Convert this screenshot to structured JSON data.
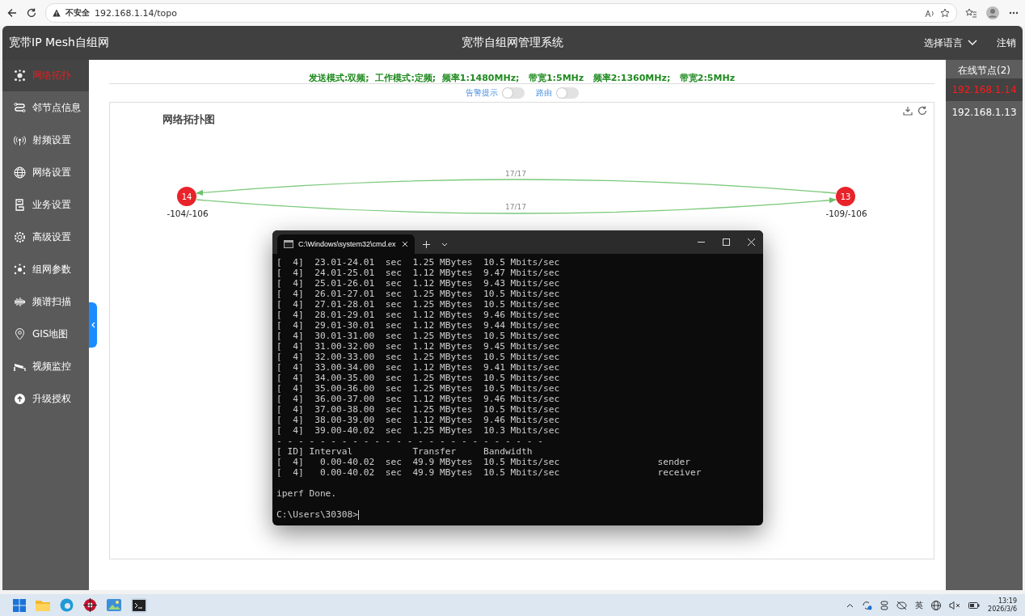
{
  "browser": {
    "security": "不安全",
    "url": "192.168.1.14/topo"
  },
  "header": {
    "brand": "宽带IP Mesh自组网",
    "title": "宽带自组网管理系统",
    "language": "选择语言",
    "logout": "注销"
  },
  "sidebar": {
    "items": [
      {
        "label": "网络拓扑",
        "selected": true
      },
      {
        "label": "邻节点信息",
        "selected": false
      },
      {
        "label": "射频设置",
        "selected": false
      },
      {
        "label": "网络设置",
        "selected": false
      },
      {
        "label": "业务设置",
        "selected": false
      },
      {
        "label": "高级设置",
        "selected": false
      },
      {
        "label": "组网参数",
        "selected": false
      },
      {
        "label": "频谱扫描",
        "selected": false
      },
      {
        "label": "GIS地图",
        "selected": false
      },
      {
        "label": "视频监控",
        "selected": false
      },
      {
        "label": "升级授权",
        "selected": false
      }
    ]
  },
  "status_line": "发送模式:双频;  工作模式:定频;  频率1:1480MHz;   带宽1:5MHz   频率2:1360MHz;   带宽2:5MHz",
  "toggles": [
    {
      "label": "告警提示",
      "on": false
    },
    {
      "label": "路由",
      "on": false
    }
  ],
  "topology": {
    "title": "网络拓扑图",
    "nodes": [
      {
        "label": "14",
        "signal": "-104/-106"
      },
      {
        "label": "13",
        "signal": "-109/-106"
      }
    ],
    "links": [
      {
        "label": "17/17",
        "points_left": true
      },
      {
        "label": "17/17",
        "points_left": false
      }
    ]
  },
  "online_nodes": {
    "title": "在线节点(2)",
    "items": [
      {
        "label": "192.168.1.14",
        "selected": true
      },
      {
        "label": "192.168.1.13",
        "selected": false
      }
    ]
  },
  "terminal": {
    "tab": "C:\\Windows\\system32\\cmd.ex",
    "lines": [
      "[  4]  23.01-24.01  sec  1.25 MBytes  10.5 Mbits/sec",
      "[  4]  24.01-25.01  sec  1.12 MBytes  9.47 Mbits/sec",
      "[  4]  25.01-26.01  sec  1.12 MBytes  9.43 Mbits/sec",
      "[  4]  26.01-27.01  sec  1.25 MBytes  10.5 Mbits/sec",
      "[  4]  27.01-28.01  sec  1.25 MBytes  10.5 Mbits/sec",
      "[  4]  28.01-29.01  sec  1.12 MBytes  9.46 Mbits/sec",
      "[  4]  29.01-30.01  sec  1.12 MBytes  9.44 Mbits/sec",
      "[  4]  30.01-31.00  sec  1.25 MBytes  10.5 Mbits/sec",
      "[  4]  31.00-32.00  sec  1.12 MBytes  9.45 Mbits/sec",
      "[  4]  32.00-33.00  sec  1.25 MBytes  10.5 Mbits/sec",
      "[  4]  33.00-34.00  sec  1.12 MBytes  9.41 Mbits/sec",
      "[  4]  34.00-35.00  sec  1.25 MBytes  10.5 Mbits/sec",
      "[  4]  35.00-36.00  sec  1.25 MBytes  10.5 Mbits/sec",
      "[  4]  36.00-37.00  sec  1.12 MBytes  9.46 Mbits/sec",
      "[  4]  37.00-38.00  sec  1.25 MBytes  10.5 Mbits/sec",
      "[  4]  38.00-39.00  sec  1.12 MBytes  9.46 Mbits/sec",
      "[  4]  39.00-40.02  sec  1.25 MBytes  10.3 Mbits/sec",
      "- - - - - - - - - - - - - - - - - - - - - - - - -",
      "[ ID] Interval           Transfer     Bandwidth",
      "[  4]   0.00-40.02  sec  49.9 MBytes  10.5 Mbits/sec                  sender",
      "[  4]   0.00-40.02  sec  49.9 MBytes  10.5 Mbits/sec                  receiver"
    ],
    "done": "iperf Done.",
    "prompt": "C:\\Users\\30308>"
  },
  "taskbar": {
    "ime": "英",
    "time": "13:19",
    "date": "2026/3/6"
  }
}
